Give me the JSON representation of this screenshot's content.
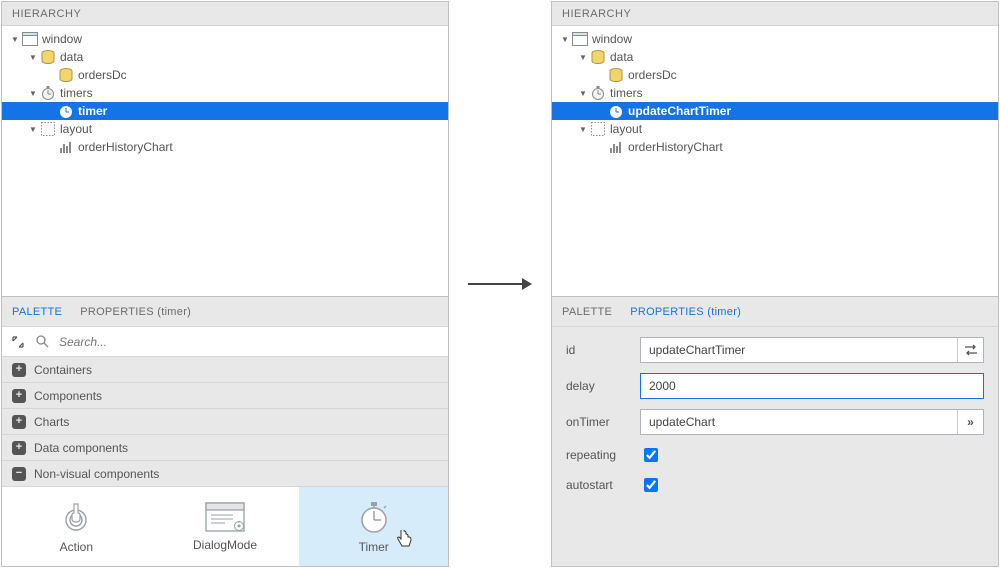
{
  "left": {
    "header": "HIERARCHY",
    "tree": {
      "window": "window",
      "data": "data",
      "ordersDc": "ordersDc",
      "timers": "timers",
      "timer": "timer",
      "layout": "layout",
      "orderHistoryChart": "orderHistoryChart"
    },
    "tabs": {
      "palette": "PALETTE",
      "properties": "PROPERTIES (timer)"
    },
    "search_placeholder": "Search...",
    "categories": {
      "containers": "Containers",
      "components": "Components",
      "charts": "Charts",
      "data_components": "Data components",
      "non_visual": "Non-visual components"
    },
    "tiles": {
      "action": "Action",
      "dialogmode": "DialogMode",
      "timer": "Timer"
    }
  },
  "right": {
    "header": "HIERARCHY",
    "tree": {
      "window": "window",
      "data": "data",
      "ordersDc": "ordersDc",
      "timers": "timers",
      "updateChartTimer": "updateChartTimer",
      "layout": "layout",
      "orderHistoryChart": "orderHistoryChart"
    },
    "tabs": {
      "palette": "PALETTE",
      "properties": "PROPERTIES (timer)"
    },
    "props": {
      "id_label": "id",
      "id_value": "updateChartTimer",
      "delay_label": "delay",
      "delay_value": "2000",
      "onTimer_label": "onTimer",
      "onTimer_value": "updateChart",
      "repeating_label": "repeating",
      "autostart_label": "autostart"
    }
  }
}
